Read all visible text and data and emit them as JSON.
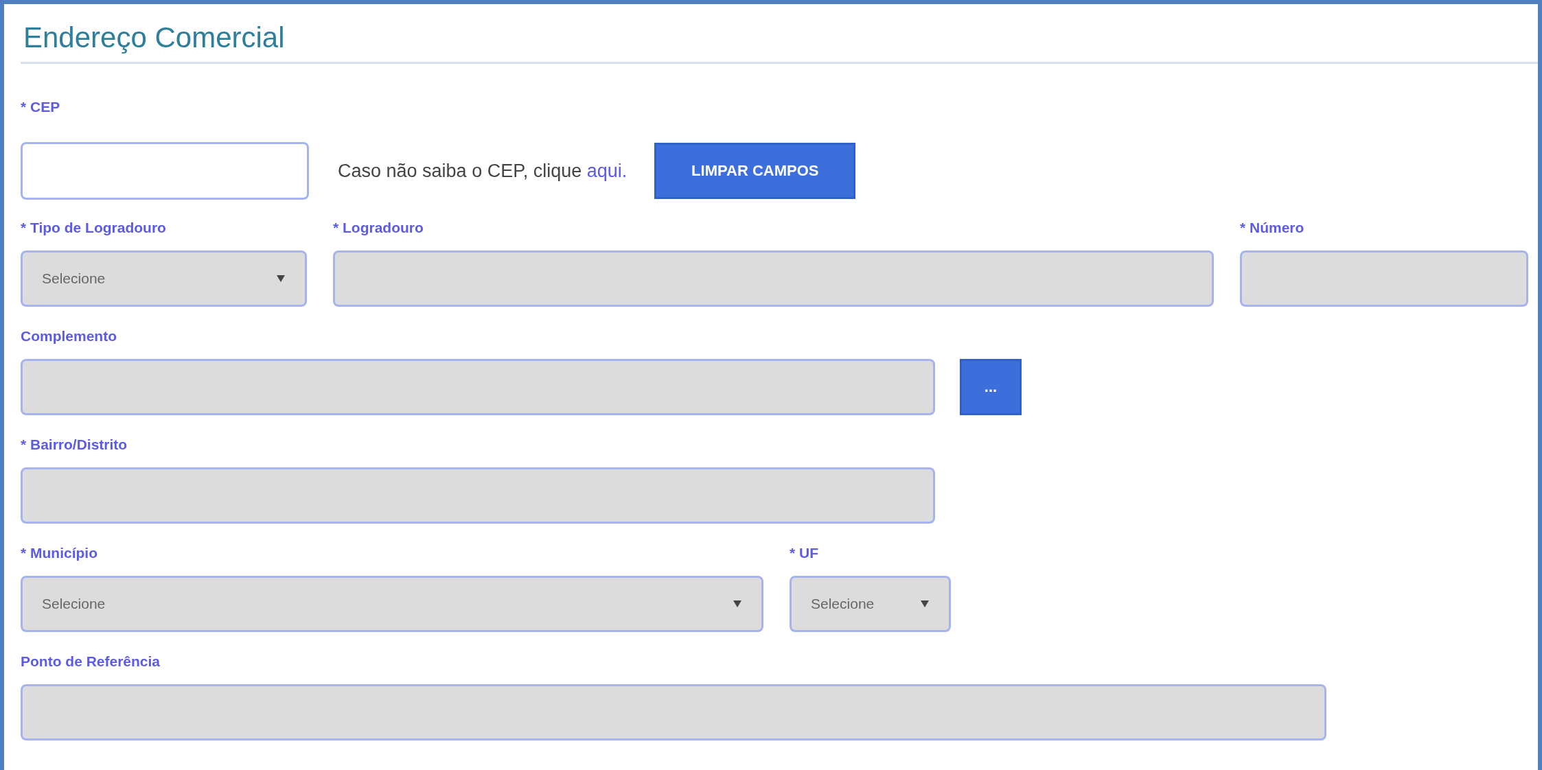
{
  "title": "Endereço Comercial",
  "cep": {
    "label": "* CEP",
    "disabled": false,
    "hint": "Caso não saiba o CEP, clique ",
    "link": "aqui.",
    "clear_button": "LIMPAR CAMPOS"
  },
  "rows": [
    [
      {
        "kind": "select",
        "label": "* Tipo de Logradouro",
        "value": "Selecione",
        "disabled": true
      },
      {
        "kind": "text",
        "label": "* Logradouro",
        "disabled": true
      },
      {
        "kind": "text",
        "label": "* Número",
        "disabled": true
      }
    ],
    [
      {
        "kind": "text",
        "label": "Complemento",
        "disabled": true
      },
      {
        "kind": "more",
        "label": "..."
      }
    ],
    [
      {
        "kind": "text",
        "label": "* Bairro/Distrito",
        "disabled": true
      }
    ],
    [
      {
        "kind": "select",
        "label": "* Município",
        "value": "Selecione",
        "disabled": true
      },
      {
        "kind": "select",
        "label": "* UF",
        "value": "Selecione",
        "disabled": true
      }
    ],
    [
      {
        "kind": "text",
        "label": "Ponto de Referência",
        "disabled": true
      }
    ]
  ]
}
